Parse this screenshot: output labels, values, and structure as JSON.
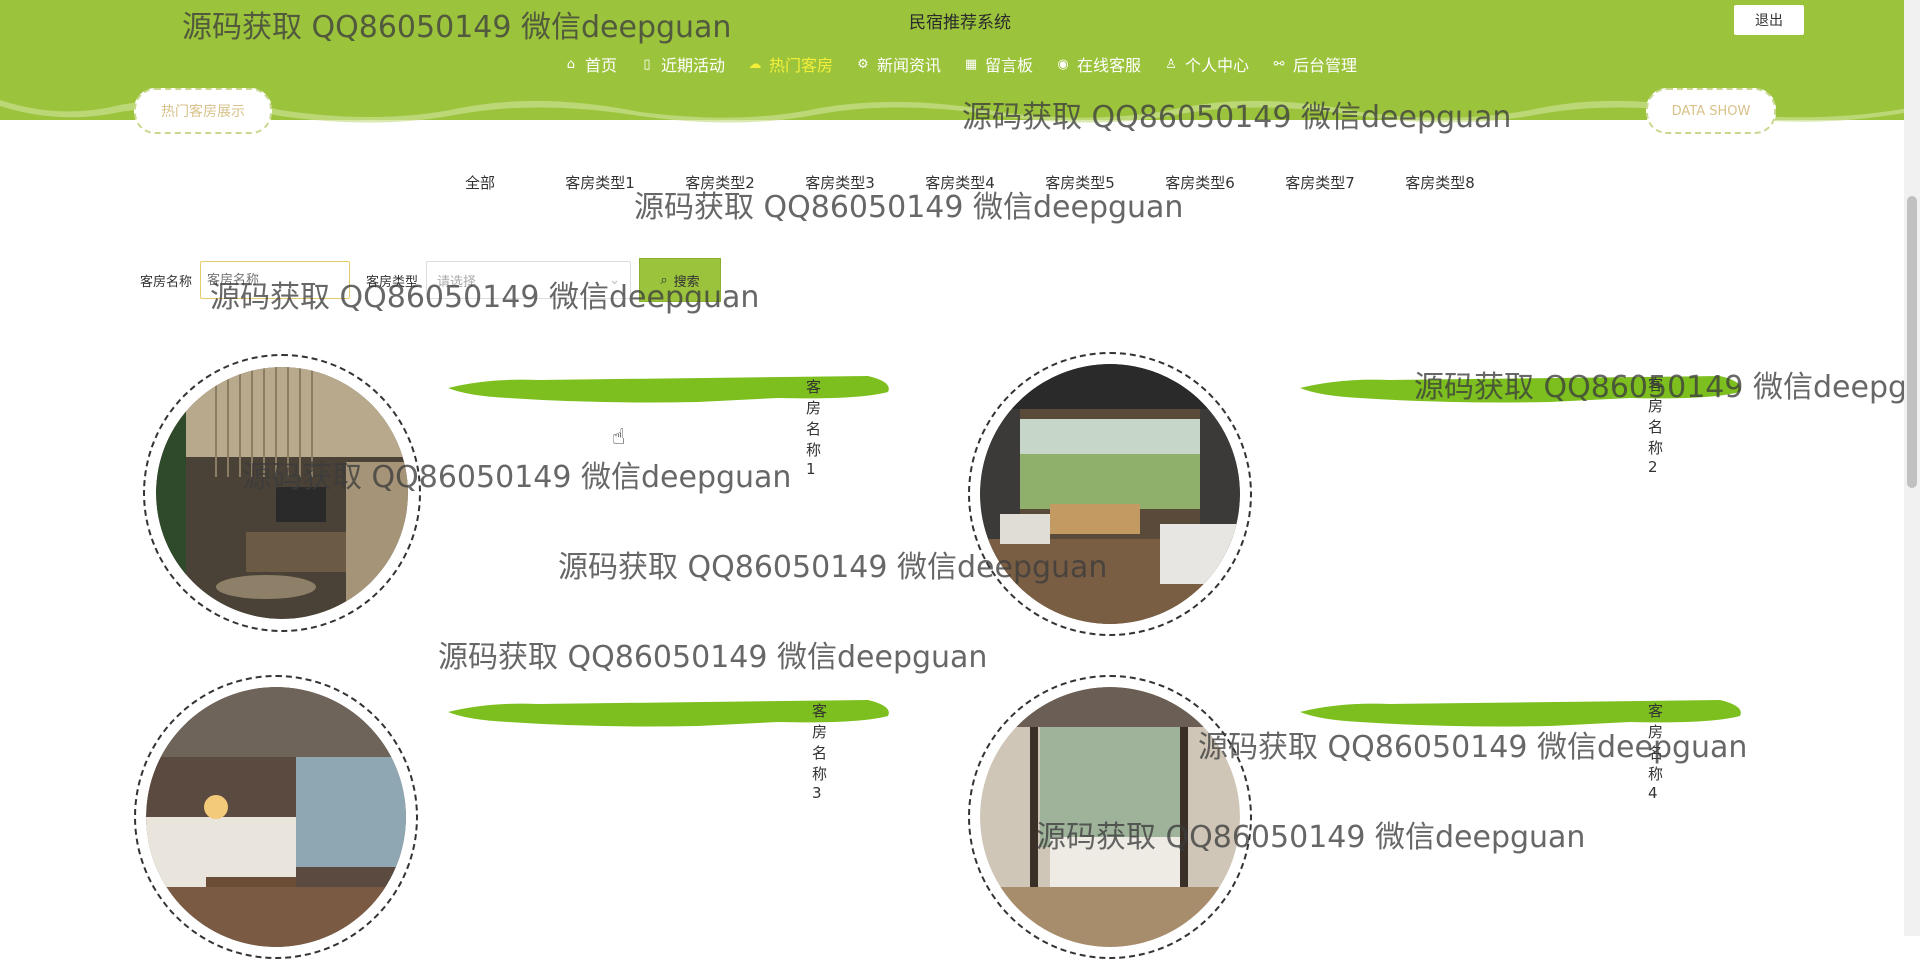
{
  "header": {
    "site_title": "民宿推荐系统",
    "logout_label": "退出",
    "nav": [
      {
        "icon": "home-icon",
        "glyph": "⌂",
        "label": "首页",
        "active": false
      },
      {
        "icon": "activity-icon",
        "glyph": "▯",
        "label": "近期活动",
        "active": false
      },
      {
        "icon": "hot-room-icon",
        "glyph": "☁",
        "label": "热门客房",
        "active": true
      },
      {
        "icon": "news-icon",
        "glyph": "⚙",
        "label": "新闻资讯",
        "active": false
      },
      {
        "icon": "board-icon",
        "glyph": "▦",
        "label": "留言板",
        "active": false
      },
      {
        "icon": "service-icon",
        "glyph": "◉",
        "label": "在线客服",
        "active": false
      },
      {
        "icon": "user-icon",
        "glyph": "♙",
        "label": "个人中心",
        "active": false
      },
      {
        "icon": "link-icon",
        "glyph": "⚯",
        "label": "后台管理",
        "active": false
      }
    ]
  },
  "section": {
    "title_left": "热门客房展示",
    "title_right": "DATA SHOW"
  },
  "tabs": [
    "全部",
    "客房类型1",
    "客房类型2",
    "客房类型3",
    "客房类型4",
    "客房类型5",
    "客房类型6",
    "客房类型7",
    "客房类型8"
  ],
  "search": {
    "name_label": "客房名称",
    "name_placeholder": "客房名称",
    "type_label": "客房类型",
    "type_placeholder": "请选择",
    "button_label": "搜索"
  },
  "rooms": [
    {
      "name": "客房名称1"
    },
    {
      "name": "客房名称2"
    },
    {
      "name": "客房名称3"
    },
    {
      "name": "客房名称4"
    }
  ],
  "watermark": "源码获取 QQ86050149 微信deepguan",
  "colors": {
    "header_green": "#9bc33c",
    "brush_green": "#7cbf1e",
    "active_nav": "#f4f03a"
  }
}
